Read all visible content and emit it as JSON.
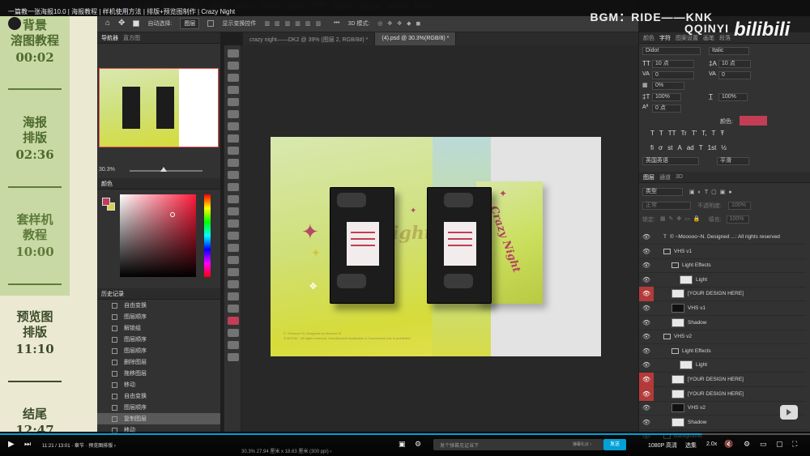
{
  "video": {
    "title": "一篇教一张海报10.0 | 海报教程 | 样机使用方法 | 排版+预览图制作 | Crazy Night",
    "bgm": "BGM：RIDE——KNK",
    "uploader": "QQINYI",
    "platform_logo": "bilibili",
    "time": "11:21 / 13:01 · 章节 · 预览图排版 ›",
    "quality": "1080P 高清",
    "select_label": "选集",
    "speed": "2.0x",
    "progress_fraction": 0.866,
    "danmaku_placeholder": "发个弹幕见证当下",
    "danmaku_etiquette": "弹幕礼仪 ›",
    "send_label": "发送"
  },
  "chapters": [
    {
      "title": "背景\n溶图教程",
      "time": "00:02"
    },
    {
      "title": "海报\n排版",
      "time": "02:36"
    },
    {
      "title": "套样机\n教程",
      "time": "10:00"
    },
    {
      "title": "预览图\n排版",
      "time": "11:10"
    },
    {
      "title": "结尾",
      "time": "12:47"
    }
  ],
  "divider_text": "———",
  "ps": {
    "menu": [
      "PS",
      "文件(F)",
      "编辑(E)",
      "图像(I)",
      "图层(L)",
      "文字(Y)",
      "选择(S)",
      "滤镜(T)",
      "3D(D)",
      "视图(V)",
      "增效工具",
      "窗口(W)",
      "帮助(H)"
    ],
    "options": {
      "auto_select": "自动选择:",
      "layer_select": "图层",
      "show_transform": "显示变换控件",
      "mode_3d": "3D 模式:"
    },
    "tabs": [
      {
        "label": "crazy night——DK2 @ 39% (图层 2, RGB/8#) *",
        "active": false
      },
      {
        "label": "(4).psd @ 30.3%(RGB/8) *",
        "active": true
      }
    ],
    "navigator": {
      "tabs": [
        "导航器",
        "直方图"
      ],
      "zoom": "30.3%"
    },
    "color_panel": {
      "title": "颜色",
      "fg_color": "#c23d55",
      "bg_color": "#d7d24a"
    },
    "history": {
      "title": "历史记录",
      "items": [
        "自由变换",
        "图层顺序",
        "解锁组",
        "图层顺序",
        "图层顺序",
        "删除图层",
        "拖移图层",
        "移动",
        "自由变换",
        "图层顺序",
        "复制图层",
        "移动"
      ],
      "active_index": 10
    },
    "status": "30.3%    27.94 厘米 x 18.63 厘米 (300 ppi)   ›",
    "character_panel": {
      "tabs": [
        "颜色",
        "字符",
        "图案设置",
        "画笔",
        "段落"
      ],
      "font": "Didot",
      "style": "Italic",
      "size": "10 点",
      "leading": "10 点",
      "kerning": "0",
      "tracking": "0",
      "scale_tsume": "0%",
      "v_scale": "100%",
      "h_scale": "100%",
      "baseline": "0 点",
      "color_label": "颜色:",
      "text_color": "#c23d55",
      "language": "英国英语",
      "anti_alias": "平滑",
      "formats": [
        "T",
        "T",
        "TT",
        "Tr",
        "T'",
        "T,",
        "T",
        "Ŧ"
      ],
      "opentype": [
        "fi",
        "ơ",
        "st",
        "A",
        "ad",
        "T",
        "1st",
        "½"
      ]
    },
    "layers": {
      "tabs": [
        "图层",
        "通道",
        "3D"
      ],
      "filter": "类型",
      "blend": "正常",
      "opacity_label": "不透明度:",
      "opacity": "100%",
      "lock_label": "锁定:",
      "fill_label": "填充:",
      "fill": "100%",
      "rows": [
        {
          "name": "© ~Mooooo~N. Designed ...: All rights reserved",
          "kind": "text",
          "indent": 0,
          "red": false
        },
        {
          "name": "VHS v1",
          "kind": "group",
          "indent": 0,
          "red": false
        },
        {
          "name": "Light Effects",
          "kind": "group",
          "indent": 1,
          "red": false
        },
        {
          "name": "Light",
          "kind": "layer",
          "indent": 2,
          "red": false
        },
        {
          "name": "[YOUR DESIGN HERE]",
          "kind": "smart",
          "indent": 1,
          "red": true
        },
        {
          "name": "VHS v1",
          "kind": "smart",
          "indent": 1,
          "red": false
        },
        {
          "name": "Shadow",
          "kind": "layer",
          "indent": 1,
          "red": false
        },
        {
          "name": "VHS v2",
          "kind": "group",
          "indent": 0,
          "red": false
        },
        {
          "name": "Light Effects",
          "kind": "group",
          "indent": 1,
          "red": false
        },
        {
          "name": "Light",
          "kind": "layer",
          "indent": 2,
          "red": false
        },
        {
          "name": "[YOUR DESIGN HERE]",
          "kind": "smart",
          "indent": 1,
          "red": true
        },
        {
          "name": "[YOUR DESIGN HERE]",
          "kind": "smart",
          "indent": 1,
          "red": true
        },
        {
          "name": "VHS v2",
          "kind": "smart",
          "indent": 1,
          "red": false
        },
        {
          "name": "Shadow",
          "kind": "layer",
          "indent": 1,
          "red": false
        },
        {
          "name": "Background",
          "kind": "group",
          "indent": 0,
          "red": false
        }
      ]
    }
  },
  "artwork": {
    "sleeve_text": "Crazy Night",
    "bg_text": "Night",
    "credit": "© ~Mooooo~N. Designed by Mooooo~N\n® MOONI · All rights reserved. Unauthorized duplication & Commercial Use is prohibited."
  }
}
